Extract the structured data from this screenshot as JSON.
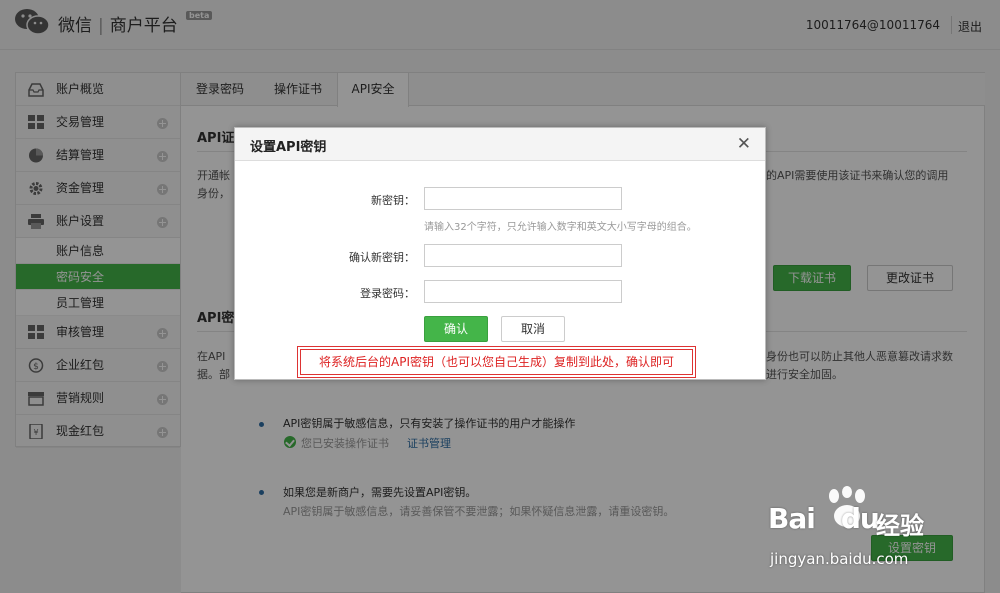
{
  "header": {
    "brand_wechat": "微信",
    "brand_separator": "|",
    "brand_platform": "商户平台",
    "beta_badge": "beta",
    "account": "10011764@10011764",
    "logout": "退出"
  },
  "sidebar": {
    "items": [
      {
        "label": "账户概览",
        "icon": "inbox-icon"
      },
      {
        "label": "交易管理",
        "icon": "grid-icon"
      },
      {
        "label": "结算管理",
        "icon": "pie-chart-icon"
      },
      {
        "label": "资金管理",
        "icon": "gear-icon"
      },
      {
        "label": "账户设置",
        "icon": "printer-icon"
      }
    ],
    "sub_items": [
      {
        "label": "账户信息"
      },
      {
        "label": "密码安全"
      },
      {
        "label": "员工管理"
      }
    ],
    "items2": [
      {
        "label": "审核管理",
        "icon": "grid-icon"
      },
      {
        "label": "企业红包",
        "icon": "coin-icon"
      },
      {
        "label": "营销规则",
        "icon": "store-icon"
      },
      {
        "label": "现金红包",
        "icon": "envelope-icon"
      }
    ]
  },
  "tabs": [
    {
      "label": "登录密码"
    },
    {
      "label": "操作证书"
    },
    {
      "label": "API安全"
    }
  ],
  "main": {
    "cert_title": "API证",
    "cert_para_left": "开通帐",
    "cert_para_left2": "身份，",
    "cert_para_right": "的API需要使用该证书来确认您的调用",
    "download_cert": "下载证书",
    "change_cert": "更改证书",
    "key_title": "API密",
    "key_para_left": "在API",
    "key_para_left2": "据。部",
    "key_para_right": "身份也可以防止其他人恶意篡改请求数",
    "key_para_right2": "进行安全加固。",
    "bullet1": "API密钥属于敏感信息，只有安装了操作证书的用户才能操作",
    "installed": "您已安装操作证书",
    "cert_manage": "证书管理",
    "bullet2": "如果您是新商户，需要先设置API密钥。",
    "bullet2_sub": "API密钥属于敏感信息，请妥善保管不要泄露；如果怀疑信息泄露，请重设密钥。",
    "set_key_btn": "设置密钥"
  },
  "dialog": {
    "title": "设置API密钥",
    "close": "✕",
    "new_key_label": "新密钥：",
    "new_key_value": "",
    "new_key_hint": "请输入32个字符，只允许输入数字和英文大小写字母的组合。",
    "confirm_key_label": "确认新密钥：",
    "confirm_key_value": "",
    "login_pwd_label": "登录密码：",
    "login_pwd_value": "",
    "confirm_btn": "确认",
    "cancel_btn": "取消"
  },
  "annotation": "将系统后台的API密钥（也可以您自己生成）复制到此处，确认即可",
  "watermark": {
    "baidu": "Bai",
    "baidu2": "du",
    "jingyan": "经验",
    "url": "jingyan.baidu.com"
  },
  "colors": {
    "accent": "#44b549",
    "link": "#2e6da4",
    "annotation": "#d22222"
  }
}
